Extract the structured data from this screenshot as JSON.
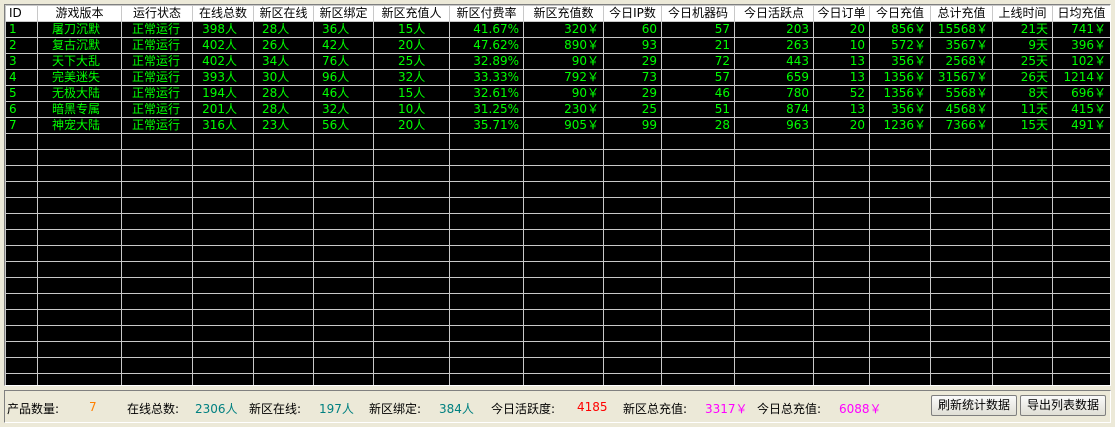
{
  "columns": [
    "ID",
    "游戏版本",
    "运行状态",
    "在线总数",
    "新区在线",
    "新区绑定",
    "新区充值人",
    "新区付费率",
    "新区充值数",
    "今日IP数",
    "今日机器码",
    "今日活跃点",
    "今日订单",
    "今日充值",
    "总计充值",
    "上线时间",
    "日均充值"
  ],
  "rows": [
    [
      "1",
      "屠刀沉默",
      "正常运行",
      "398人",
      "28人",
      "36人",
      "15人",
      "41.67%",
      "320￥",
      "60",
      "57",
      "203",
      "20",
      "856￥",
      "15568￥",
      "21天",
      "741￥"
    ],
    [
      "2",
      "复古沉默",
      "正常运行",
      "402人",
      "26人",
      "42人",
      "20人",
      "47.62%",
      "890￥",
      "93",
      "21",
      "263",
      "10",
      "572￥",
      "3567￥",
      "9天",
      "396￥"
    ],
    [
      "3",
      "天下大乱",
      "正常运行",
      "402人",
      "34人",
      "76人",
      "25人",
      "32.89%",
      "90￥",
      "29",
      "72",
      "443",
      "13",
      "356￥",
      "2568￥",
      "25天",
      "102￥"
    ],
    [
      "4",
      "完美迷失",
      "正常运行",
      "393人",
      "30人",
      "96人",
      "32人",
      "33.33%",
      "792￥",
      "73",
      "57",
      "659",
      "13",
      "1356￥",
      "31567￥",
      "26天",
      "1214￥"
    ],
    [
      "5",
      "无极大陆",
      "正常运行",
      "194人",
      "28人",
      "46人",
      "15人",
      "32.61%",
      "90￥",
      "29",
      "46",
      "780",
      "52",
      "1356￥",
      "5568￥",
      "8天",
      "696￥"
    ],
    [
      "6",
      "暗黑专属",
      "正常运行",
      "201人",
      "28人",
      "32人",
      "10人",
      "31.25%",
      "230￥",
      "25",
      "51",
      "874",
      "13",
      "356￥",
      "4568￥",
      "11天",
      "415￥"
    ],
    [
      "7",
      "神宠大陆",
      "正常运行",
      "316人",
      "23人",
      "56人",
      "20人",
      "35.71%",
      "905￥",
      "99",
      "28",
      "963",
      "20",
      "1236￥",
      "7366￥",
      "15天",
      "491￥"
    ]
  ],
  "status": {
    "product_count_label": "产品数量:",
    "product_count": "7",
    "online_total_label": "在线总数:",
    "online_total": "2306人",
    "new_online_label": "新区在线:",
    "new_online": "197人",
    "new_bind_label": "新区绑定:",
    "new_bind": "384人",
    "activity_label": "今日活跃度:",
    "activity": "4185",
    "new_recharge_label": "新区总充值:",
    "new_recharge": "3317￥",
    "today_recharge_label": "今日总充值:",
    "today_recharge": "6088￥"
  },
  "buttons": {
    "refresh": "刷新统计数据",
    "export": "导出列表数据"
  },
  "colors": {
    "grid_bg": "#000000",
    "grid_text": "#00ff00",
    "product_count": "#ff8000",
    "online_total": "#008080",
    "new_online": "#008080",
    "new_bind": "#008080",
    "activity": "#ff0000",
    "new_recharge": "#ff00ff",
    "today_recharge": "#ff00ff"
  }
}
